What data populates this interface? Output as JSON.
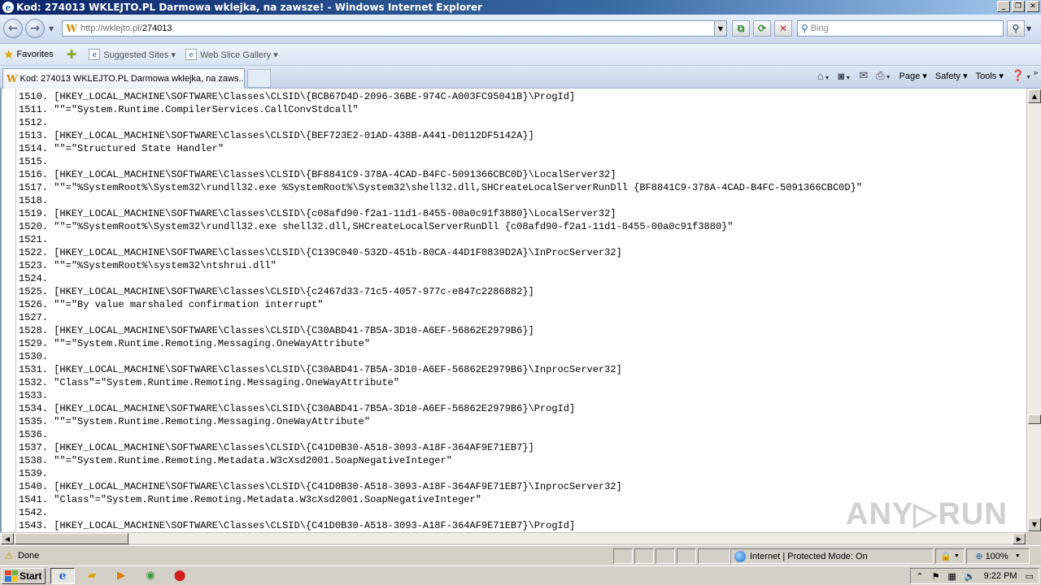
{
  "window": {
    "title": "Kod: 274013 WKLEJTO.PL Darmowa wklejka, na zawsze! - Windows Internet Explorer",
    "min": "_",
    "max": "❐",
    "close": "✕"
  },
  "nav": {
    "back_icon": "back-arrow-icon",
    "forward_icon": "forward-arrow-icon",
    "url_host": "http://wklejto.pl/",
    "url_path": "274013",
    "search_placeholder": "Bing"
  },
  "favorites": {
    "favorites_label": "Favorites",
    "suggested_label": "Suggested Sites ▾",
    "webslice_label": "Web Slice Gallery ▾"
  },
  "tab": {
    "title": "Kod: 274013 WKLEJTO.PL Darmowa wklejka, na zaws..."
  },
  "commands": {
    "page": "Page ▾",
    "safety": "Safety ▾",
    "tools": "Tools ▾"
  },
  "content": {
    "lines": [
      {
        "num": "1510.",
        "text": "[HKEY_LOCAL_MACHINE\\SOFTWARE\\Classes\\CLSID\\{BCB67D4D-2096-36BE-974C-A003FC95041B}\\ProgId]"
      },
      {
        "num": "1511.",
        "text": "\"\"=\"System.Runtime.CompilerServices.CallConvStdcall\""
      },
      {
        "num": "1512.",
        "text": ""
      },
      {
        "num": "1513.",
        "text": "[HKEY_LOCAL_MACHINE\\SOFTWARE\\Classes\\CLSID\\{BEF723E2-01AD-438B-A441-D0112DF5142A}]"
      },
      {
        "num": "1514.",
        "text": "\"\"=\"Structured State Handler\""
      },
      {
        "num": "1515.",
        "text": ""
      },
      {
        "num": "1516.",
        "text": "[HKEY_LOCAL_MACHINE\\SOFTWARE\\Classes\\CLSID\\{BF8841C9-378A-4CAD-B4FC-5091366CBC0D}\\LocalServer32]"
      },
      {
        "num": "1517.",
        "text": "\"\"=\"%SystemRoot%\\System32\\rundll32.exe %SystemRoot%\\System32\\shell32.dll,SHCreateLocalServerRunDll {BF8841C9-378A-4CAD-B4FC-5091366CBC0D}\""
      },
      {
        "num": "1518.",
        "text": ""
      },
      {
        "num": "1519.",
        "text": "[HKEY_LOCAL_MACHINE\\SOFTWARE\\Classes\\CLSID\\{c08afd90-f2a1-11d1-8455-00a0c91f3880}\\LocalServer32]"
      },
      {
        "num": "1520.",
        "text": "\"\"=\"%SystemRoot%\\System32\\rundll32.exe shell32.dll,SHCreateLocalServerRunDll {c08afd90-f2a1-11d1-8455-00a0c91f3880}\""
      },
      {
        "num": "1521.",
        "text": ""
      },
      {
        "num": "1522.",
        "text": "[HKEY_LOCAL_MACHINE\\SOFTWARE\\Classes\\CLSID\\{C139C040-532D-451b-80CA-44D1F0839D2A}\\InProcServer32]"
      },
      {
        "num": "1523.",
        "text": "\"\"=\"%SystemRoot%\\system32\\ntshrui.dll\""
      },
      {
        "num": "1524.",
        "text": ""
      },
      {
        "num": "1525.",
        "text": "[HKEY_LOCAL_MACHINE\\SOFTWARE\\Classes\\CLSID\\{c2467d33-71c5-4057-977c-e847c2286882}]"
      },
      {
        "num": "1526.",
        "text": "\"\"=\"By value marshaled confirmation interrupt\""
      },
      {
        "num": "1527.",
        "text": ""
      },
      {
        "num": "1528.",
        "text": "[HKEY_LOCAL_MACHINE\\SOFTWARE\\Classes\\CLSID\\{C30ABD41-7B5A-3D10-A6EF-56862E2979B6}]"
      },
      {
        "num": "1529.",
        "text": "\"\"=\"System.Runtime.Remoting.Messaging.OneWayAttribute\""
      },
      {
        "num": "1530.",
        "text": ""
      },
      {
        "num": "1531.",
        "text": "[HKEY_LOCAL_MACHINE\\SOFTWARE\\Classes\\CLSID\\{C30ABD41-7B5A-3D10-A6EF-56862E2979B6}\\InprocServer32]"
      },
      {
        "num": "1532.",
        "text": "\"Class\"=\"System.Runtime.Remoting.Messaging.OneWayAttribute\""
      },
      {
        "num": "1533.",
        "text": ""
      },
      {
        "num": "1534.",
        "text": "[HKEY_LOCAL_MACHINE\\SOFTWARE\\Classes\\CLSID\\{C30ABD41-7B5A-3D10-A6EF-56862E2979B6}\\ProgId]"
      },
      {
        "num": "1535.",
        "text": "\"\"=\"System.Runtime.Remoting.Messaging.OneWayAttribute\""
      },
      {
        "num": "1536.",
        "text": ""
      },
      {
        "num": "1537.",
        "text": "[HKEY_LOCAL_MACHINE\\SOFTWARE\\Classes\\CLSID\\{C41D0B30-A518-3093-A18F-364AF9E71EB7}]"
      },
      {
        "num": "1538.",
        "text": "\"\"=\"System.Runtime.Remoting.Metadata.W3cXsd2001.SoapNegativeInteger\""
      },
      {
        "num": "1539.",
        "text": ""
      },
      {
        "num": "1540.",
        "text": "[HKEY_LOCAL_MACHINE\\SOFTWARE\\Classes\\CLSID\\{C41D0B30-A518-3093-A18F-364AF9E71EB7}\\InprocServer32]"
      },
      {
        "num": "1541.",
        "text": "\"Class\"=\"System.Runtime.Remoting.Metadata.W3cXsd2001.SoapNegativeInteger\""
      },
      {
        "num": "1542.",
        "text": ""
      },
      {
        "num": "1543.",
        "text": "[HKEY_LOCAL_MACHINE\\SOFTWARE\\Classes\\CLSID\\{C41D0B30-A518-3093-A18F-364AF9E71EB7}\\ProgId]"
      }
    ]
  },
  "watermark": "ANY▷RUN",
  "status": {
    "text": "Done",
    "zone": "Internet | Protected Mode: On",
    "zoom": "100%"
  },
  "taskbar": {
    "start_label": "Start",
    "clock": "9:22 PM"
  },
  "colors": {
    "title_gradient_start": "#0a246a",
    "content_bg": "#ffffff",
    "chrome": "#d4d0c8"
  }
}
